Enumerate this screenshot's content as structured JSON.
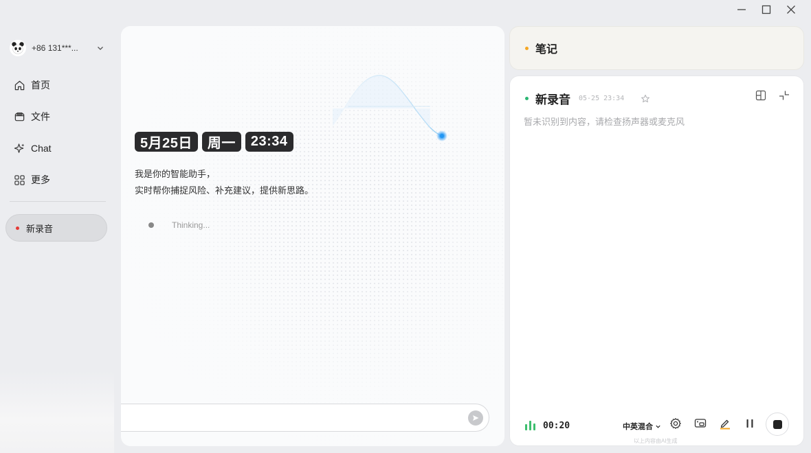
{
  "account": {
    "phone": "+86 131***...",
    "avatar_icon": "panda-avatar-icon"
  },
  "nav": {
    "items": [
      {
        "label": "首页",
        "icon": "home-icon"
      },
      {
        "label": "文件",
        "icon": "folder-icon"
      },
      {
        "label": "Chat",
        "icon": "sparkle-icon"
      },
      {
        "label": "更多",
        "icon": "grid-icon"
      }
    ]
  },
  "recordings": [
    {
      "label": "新录音",
      "status_color": "#e53935"
    }
  ],
  "chat": {
    "date": "5月25日",
    "weekday": "周一",
    "time": "23:34",
    "greeting_line1": "我是你的智能助手，",
    "greeting_line2": "实时帮你捕捉风险、补充建议，提供新思路。",
    "thinking": "Thinking...",
    "input_placeholder": ""
  },
  "notes": {
    "title": "笔记",
    "accent": "#f5a623"
  },
  "recording": {
    "title": "新录音",
    "timestamp": "05-25 23:34",
    "empty_hint": "暂未识别到内容，请检查扬声器或麦克风",
    "timer": "00:20",
    "language": "中英混合",
    "ai_note": "以上内容由AI生成",
    "status_color": "#2bb673"
  },
  "colors": {
    "accent_blue": "#2196f3",
    "chip_bg": "#2b2b2d"
  }
}
